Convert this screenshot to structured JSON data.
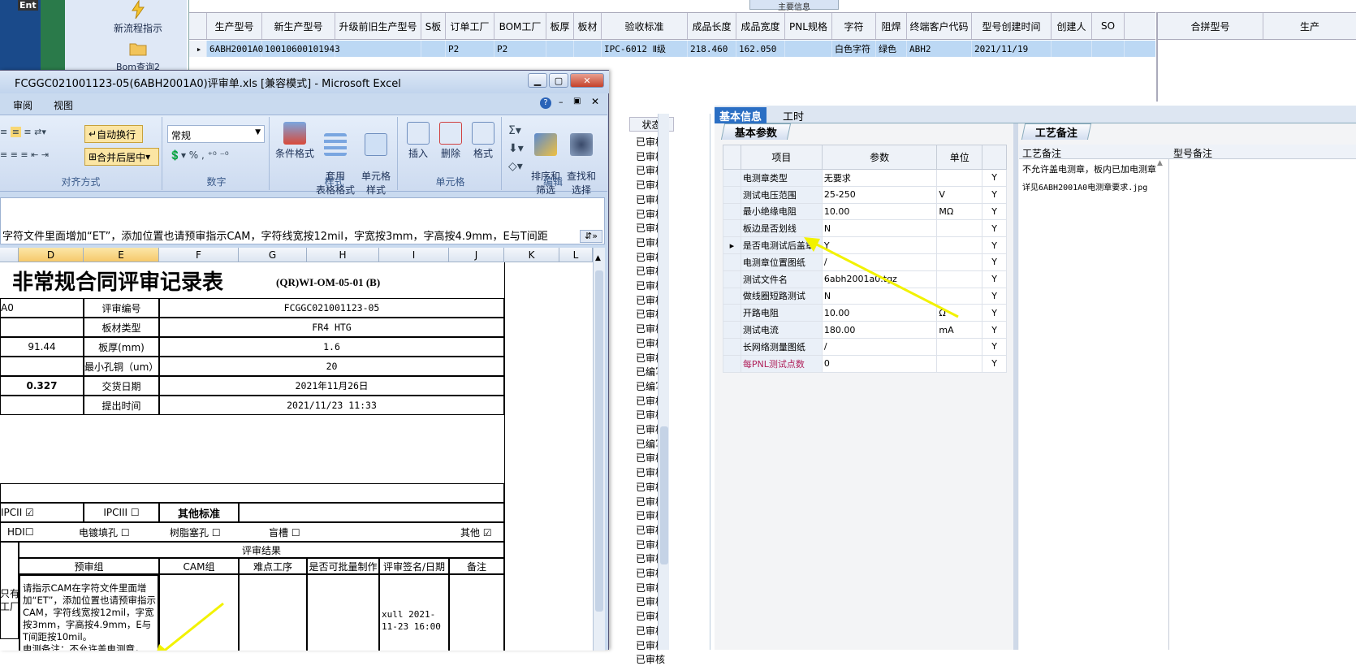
{
  "launcher": {
    "items": [
      {
        "label": "新流程指示"
      },
      {
        "label": "Bom查询2"
      }
    ],
    "top_label": "Ent"
  },
  "topgrid": {
    "tab": "主要信息",
    "columns": [
      "生产型号",
      "新生产型号",
      "升级前旧生产型号",
      "S板",
      "订单工厂",
      "BOM工厂",
      "板厚",
      "板材",
      "验收标准",
      "成品长度",
      "成品宽度",
      "PNL规格",
      "字符",
      "阻焊",
      "终端客户代码",
      "型号创建时间",
      "创建人",
      "SO"
    ],
    "row": [
      "6ABH2001A0",
      "10010600101943",
      "",
      "",
      "P2",
      "P2",
      "",
      "",
      "IPC-6012 Ⅱ级",
      "218.460",
      "162.050",
      "",
      "白色字符",
      "绿色",
      "ABH2",
      "2021/11/19",
      "",
      ""
    ],
    "side_columns": [
      "合拼型号",
      "生产"
    ]
  },
  "rpane": {
    "tabs": [
      "基本信息",
      "工时"
    ],
    "subtab_left": "基本参数",
    "subtab_right": "工艺备注",
    "param_headers": [
      "项目",
      "参数",
      "单位"
    ],
    "params": [
      {
        "name": "电测章类型",
        "value": "无要求",
        "unit": "",
        "flag": "Y"
      },
      {
        "name": "测试电压范围",
        "value": "25-250",
        "unit": "V",
        "flag": "Y"
      },
      {
        "name": "最小绝缘电阻",
        "value": "10.00",
        "unit": "MΩ",
        "flag": "Y"
      },
      {
        "name": "板边是否划线",
        "value": "N",
        "unit": "",
        "flag": "Y"
      },
      {
        "name": "是否电测试后盖章",
        "value": "Y",
        "unit": "",
        "flag": "Y"
      },
      {
        "name": "电测章位置图纸",
        "value": "/",
        "unit": "",
        "flag": "Y"
      },
      {
        "name": "测试文件名",
        "value": "6abh2001a0.tgz",
        "unit": "",
        "flag": "Y"
      },
      {
        "name": "做线圈短路测试",
        "value": "N",
        "unit": "",
        "flag": "Y"
      },
      {
        "name": "开路电阻",
        "value": "10.00",
        "unit": "Ω",
        "flag": "Y"
      },
      {
        "name": "测试电流",
        "value": "180.00",
        "unit": "mA",
        "flag": "Y"
      },
      {
        "name": "长网络测量图纸",
        "value": "/",
        "unit": "",
        "flag": "Y"
      },
      {
        "name": "每PNL测试点数",
        "value": "0",
        "unit": "",
        "flag": "Y"
      }
    ],
    "notes_headers": [
      "工艺备注",
      "型号备注"
    ],
    "notes_lines": [
      "不允许盖电测章，板内已加电测章",
      "详见6ABH2001A0电测章要求.jpg"
    ]
  },
  "statuscol": {
    "header": "状态",
    "items": [
      "已审核",
      "已审核",
      "已审核",
      "已审核",
      "已审核",
      "已审核",
      "已审核",
      "已审核",
      "已审核",
      "已审核",
      "已审核",
      "已审核",
      "已审核",
      "已审核",
      "已审核",
      "已审核",
      "已编写",
      "已编写",
      "已审核",
      "已审核",
      "已审核",
      "已编写",
      "已审核",
      "已审核",
      "已审核",
      "已审核",
      "已审核",
      "已审核",
      "已审核",
      "已审核",
      "已审核",
      "已审核",
      "已审核",
      "已审核",
      "已审核",
      "已审核",
      "已审核"
    ]
  },
  "excel": {
    "title": "FCGGC021001123-05(6ABH2001A0)评审单.xls  [兼容模式] - Microsoft Excel",
    "ribbon_tabs": [
      "审阅",
      "视图"
    ],
    "buttons": {
      "wrap": "自动换行",
      "merge": "合并后居中",
      "numformat": "常规",
      "condfmt": "条件格式",
      "tablefmt": "套用\n表格格式",
      "cellstyle": "单元格\n样式",
      "insert": "插入",
      "delete": "删除",
      "format": "格式",
      "sortfilter": "排序和\n筛选",
      "findselect": "查找和\n选择"
    },
    "groups": [
      "对齐方式",
      "数字",
      "样式",
      "单元格",
      "编辑"
    ],
    "formula": "字符文件里面增加“ET”，添加位置也请预审指示CAM，字符线宽按12mil，字宽按3mm，字高按4.9mm，E与T间距",
    "columns": [
      "D",
      "E",
      "F",
      "G",
      "H",
      "I",
      "J",
      "K",
      "L"
    ],
    "sheet": {
      "title": "非常规合同评审记录表",
      "code": "(QR)WI-OM-05-01 (B)",
      "rows": [
        {
          "left": "A0",
          "label": "评审编号",
          "value": "FCGGC021001123-05"
        },
        {
          "left": "",
          "label": "板材类型",
          "value": "FR4 HTG"
        },
        {
          "left": "91.44",
          "label": "板厚(mm)",
          "value": "1.6"
        },
        {
          "left": "",
          "label": "最小孔铜（um）",
          "value": "20"
        },
        {
          "left": "0.327",
          "label": "交货日期",
          "value": "2021年11月26日"
        },
        {
          "left": "",
          "label": "提出时间",
          "value": "2021/11/23 11:33"
        }
      ],
      "ipc2": "IPCII",
      "ipc3": "IPCIII",
      "other_std": "其他标准",
      "opts": [
        "HDI",
        "电镀填孔",
        "树脂塞孔",
        "盲槽",
        "其他"
      ],
      "result_header": "评审结果",
      "result_cols": [
        "预审组",
        "CAM组",
        "难点工序",
        "是否可批量制作",
        "评审签名/日期",
        "备注"
      ],
      "left_frag1": "只有",
      "left_frag2": "工厂",
      "pre_review": "请指示CAM在字符文件里面增加“ET”，添加位置也请预审指示CAM，字符线宽按12mil，字宽按3mm，字高按4.9mm，E与T间距按10mil。\n电测备注：不允许盖电测章，",
      "signature": "xull 2021-11-23 16:00"
    }
  }
}
